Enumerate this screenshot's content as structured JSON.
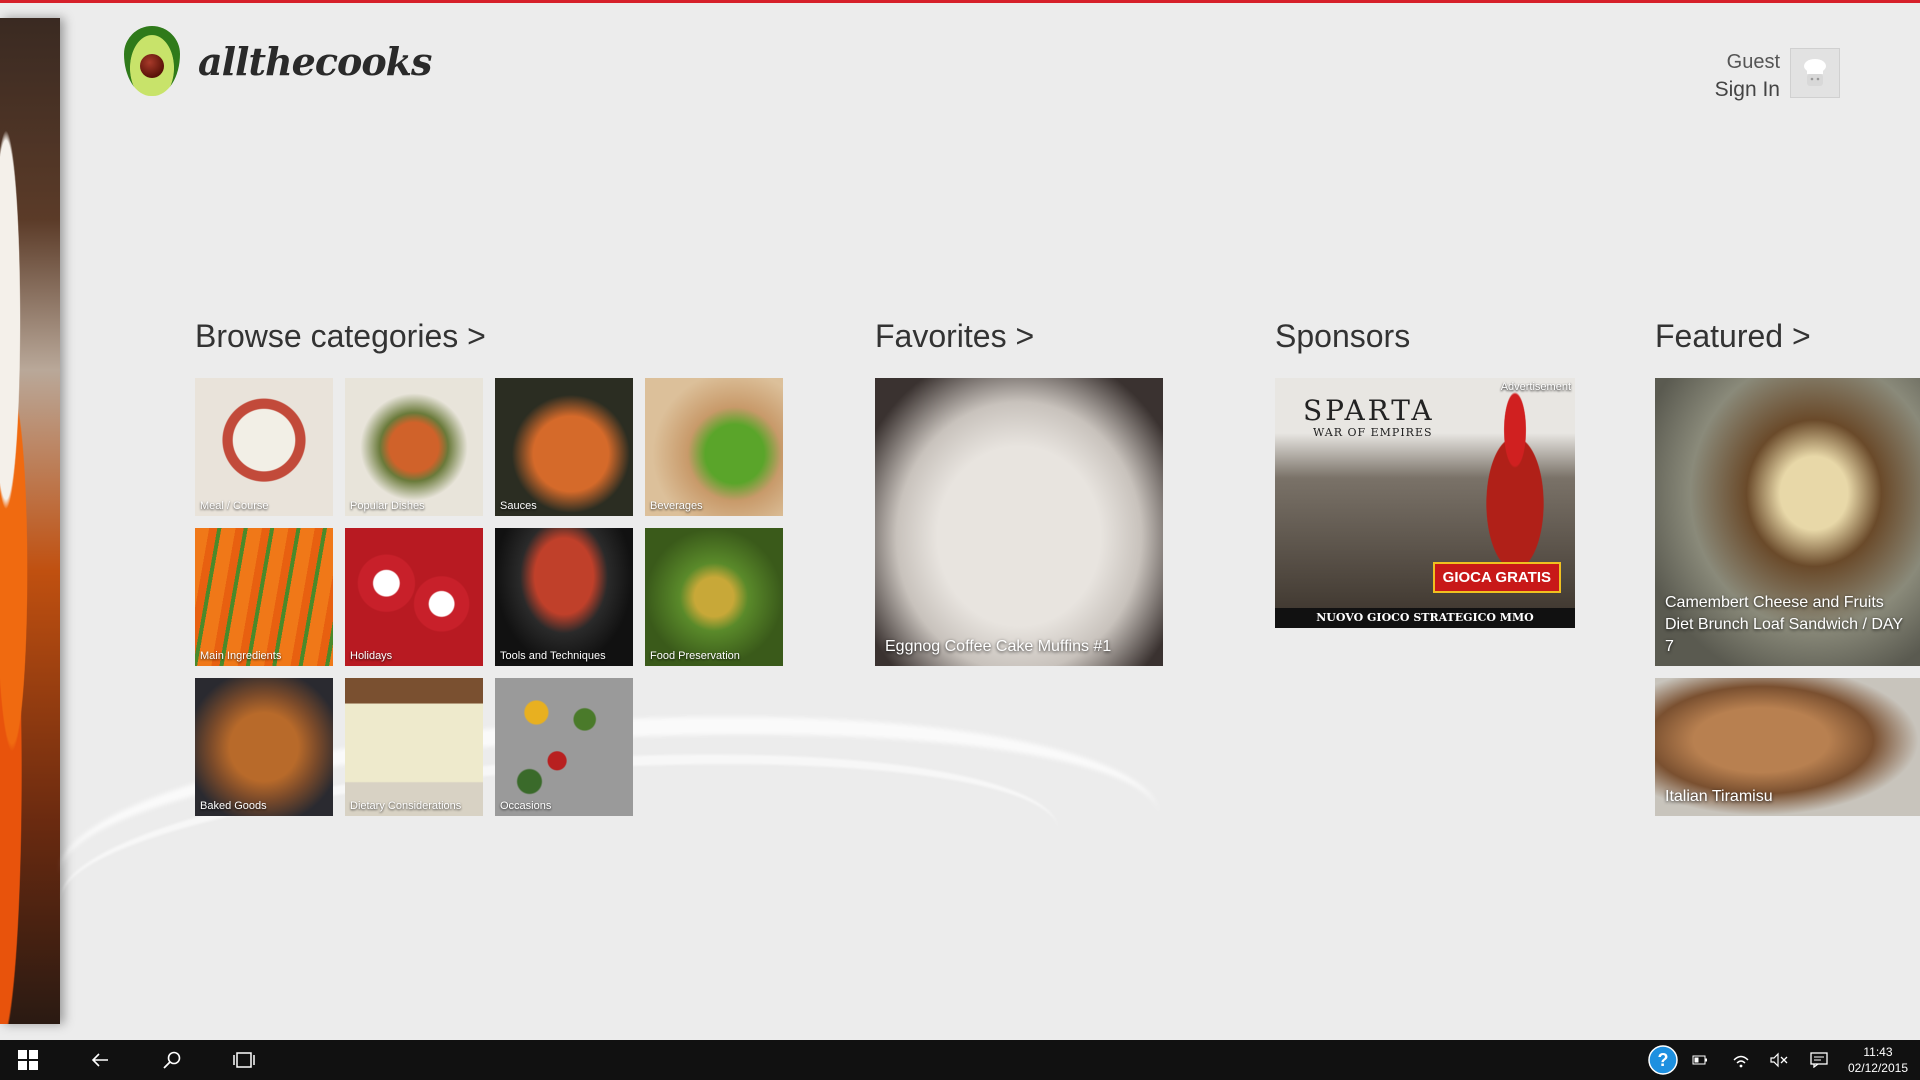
{
  "app": {
    "logo_text": "allthecooks",
    "accent_color": "#d6202a"
  },
  "user": {
    "name": "Guest",
    "sign_in_label": "Sign In"
  },
  "sections": {
    "browse": {
      "title": "Browse categories >",
      "categories": [
        "Meal / Course",
        "Popular Dishes",
        "Sauces",
        "Beverages",
        "Main Ingredients",
        "Holidays",
        "Tools and Techniques",
        "Food Preservation",
        "Baked Goods",
        "Dietary Considerations",
        "Occasions"
      ]
    },
    "favorites": {
      "title": "Favorites >",
      "items": [
        "Eggnog Coffee Cake Muffins #1"
      ]
    },
    "sponsors": {
      "title": "Sponsors",
      "ad": {
        "label": "Advertisement",
        "game_title": "SPARTA",
        "game_subtitle": "WAR OF EMPIRES",
        "cta": "GIOCA GRATIS",
        "tagline": "NUOVO GIOCO STRATEGICO MMO"
      }
    },
    "featured": {
      "title": "Featured >",
      "items": [
        "Camembert Cheese and Fruits Diet Brunch Loaf Sandwich / DAY 7",
        "Italian Tiramisu"
      ]
    }
  },
  "taskbar": {
    "time": "11:43",
    "date": "02/12/2015",
    "icons": [
      "windows-icon",
      "back-icon",
      "search-icon",
      "task-view-icon",
      "help-icon",
      "battery-icon",
      "wifi-icon",
      "volume-muted-icon",
      "notifications-icon"
    ]
  }
}
